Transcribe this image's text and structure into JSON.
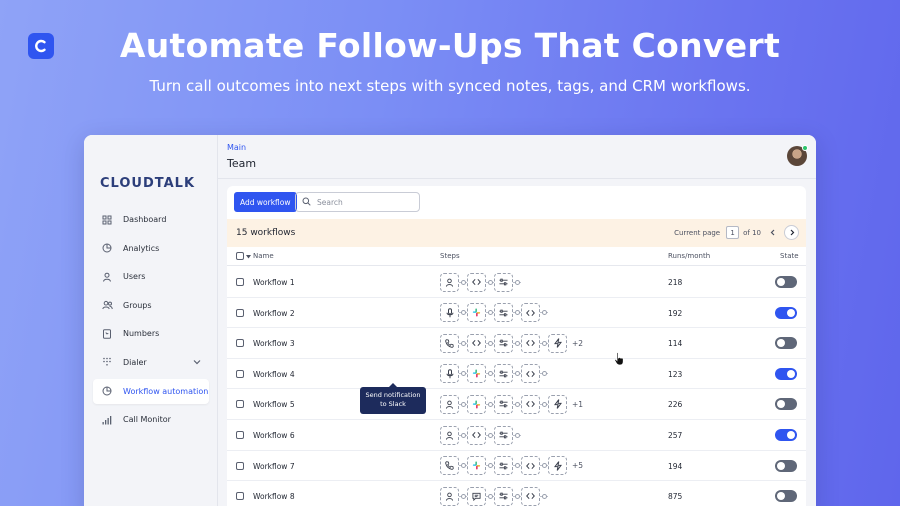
{
  "hero": {
    "title": "Automate Follow-Ups That Convert",
    "subtitle": "Turn call outcomes into next steps with synced notes, tags, and CRM workflows."
  },
  "brand": {
    "logo_text": "CLOUDTALK",
    "accent": "#2f55f0"
  },
  "sidebar": {
    "items": [
      {
        "label": "Dashboard",
        "icon": "dashboard-icon"
      },
      {
        "label": "Analytics",
        "icon": "pie-chart-icon"
      },
      {
        "label": "Users",
        "icon": "user-icon"
      },
      {
        "label": "Groups",
        "icon": "users-icon"
      },
      {
        "label": "Numbers",
        "icon": "phone-book-icon"
      },
      {
        "label": "Dialer",
        "icon": "dialpad-icon"
      },
      {
        "label": "Workflow automation",
        "icon": "pie-chart-icon",
        "active": true
      },
      {
        "label": "Call Monitor",
        "icon": "signal-bars-icon"
      }
    ]
  },
  "header": {
    "breadcrumb": "Main",
    "title": "Team"
  },
  "toolbar": {
    "add_label": "Add workflow",
    "search_placeholder": "Search"
  },
  "summary": {
    "count": "15 workflows",
    "pager_label": "Current page",
    "page": "1",
    "of_label": "of 10"
  },
  "table": {
    "columns": {
      "name": "Name",
      "steps": "Steps",
      "runs": "Runs/month",
      "state": "State"
    },
    "rows": [
      {
        "name": "Workflow 1",
        "runs": "218",
        "state": false
      },
      {
        "name": "Workflow 2",
        "runs": "192",
        "state": true
      },
      {
        "name": "Workflow 3",
        "runs": "114",
        "state": false,
        "extra": "+2"
      },
      {
        "name": "Workflow 4",
        "runs": "123",
        "state": true
      },
      {
        "name": "Workflow 5",
        "runs": "226",
        "state": false,
        "extra": "+1"
      },
      {
        "name": "Workflow 6",
        "runs": "257",
        "state": true
      },
      {
        "name": "Workflow 7",
        "runs": "194",
        "state": false,
        "extra": "+5"
      },
      {
        "name": "Workflow 8",
        "runs": "875",
        "state": false
      }
    ]
  },
  "tooltip": {
    "line1": "Send notification",
    "line2": "to Slack"
  }
}
